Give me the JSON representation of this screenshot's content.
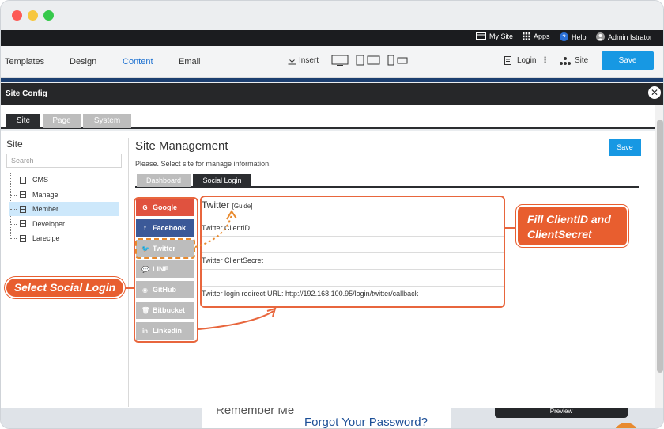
{
  "topbar": {
    "my_site": "My Site",
    "apps": "Apps",
    "help": "Help",
    "user": "Admin Istrator"
  },
  "menubar": {
    "templates": "Templates",
    "design": "Design",
    "content": "Content",
    "email": "Email",
    "insert": "Insert",
    "login": "Login",
    "site": "Site",
    "save": "Save"
  },
  "modal": {
    "title": "Site Config",
    "close_glyph": "✕",
    "tabs": [
      "Site",
      "Page",
      "System"
    ]
  },
  "sidebar": {
    "title": "Site",
    "search_placeholder": "Search",
    "items": [
      "CMS",
      "Manage",
      "Member",
      "Developer",
      "Larecipe"
    ],
    "selected": "Member"
  },
  "main": {
    "title": "Site Management",
    "subtitle": "Please. Select site for manage information.",
    "save": "Save",
    "subtabs": [
      "Dashboard",
      "Social Login"
    ]
  },
  "social": {
    "buttons": [
      {
        "label": "Google",
        "icon": "G",
        "color": "#e0523f"
      },
      {
        "label": "Facebook",
        "icon": "f",
        "color": "#3b5998"
      },
      {
        "label": "Twitter",
        "icon": "🐦",
        "color": "#bdbdbd"
      },
      {
        "label": "LINE",
        "icon": "💬",
        "color": "#bdbdbd"
      },
      {
        "label": "GitHub",
        "icon": "◉",
        "color": "#bdbdbd"
      },
      {
        "label": "Bitbucket",
        "icon": "🗑",
        "color": "#bdbdbd"
      },
      {
        "label": "Linkedin",
        "icon": "in",
        "color": "#bdbdbd"
      }
    ]
  },
  "twitter": {
    "title": "Twitter",
    "guide": "[Guide]",
    "client_id_label": "Twitter ClientID",
    "client_secret_label": "Twitter ClientSecret",
    "redirect": "Twitter login redirect URL: http://192.168.100.95/login/twitter/callback"
  },
  "callouts": {
    "select_social": "Select Social Login",
    "fill_line1": "Fill ClientID and",
    "fill_line2": "ClientSecret"
  },
  "background": {
    "remember": "Remember Me",
    "forgot": "Forgot Your Password?",
    "preview": "Preview"
  },
  "colors": {
    "accent": "#1798e3",
    "annotation": "#e85e2f",
    "dark": "#262729"
  }
}
